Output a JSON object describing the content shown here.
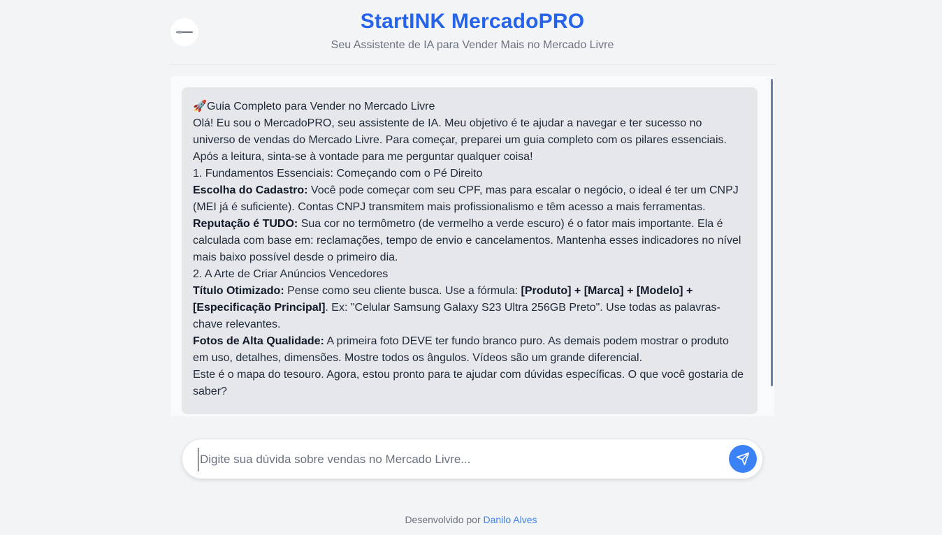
{
  "header": {
    "title": "StartINK MercadoPRO",
    "subtitle": "Seu Assistente de IA para Vender Mais no Mercado Livre"
  },
  "message": {
    "heading_icon": "rocket-icon",
    "heading_emoji": "🚀",
    "heading": "Guia Completo para Vender no Mercado Livre",
    "intro": "Olá! Eu sou o MercadoPRO, seu assistente de IA. Meu objetivo é te ajudar a navegar e ter sucesso no universo de vendas do Mercado Livre. Para começar, preparei um guia completo com os pilares essenciais. Após a leitura, sinta-se à vontade para me perguntar qualquer coisa!",
    "section1": "1. Fundamentos Essenciais: Começando com o Pé Direito",
    "cadastro_label": "Escolha do Cadastro:",
    "cadastro_text": " Você pode começar com seu CPF, mas para escalar o negócio, o ideal é ter um CNPJ (MEI já é suficiente). Contas CNPJ transmitem mais profissionalismo e têm acesso a mais ferramentas.",
    "reputacao_label": "Reputação é TUDO:",
    "reputacao_text": " Sua cor no termômetro (de vermelho a verde escuro) é o fator mais importante. Ela é calculada com base em: reclamações, tempo de envio e cancelamentos. Mantenha esses indicadores no nível mais baixo possível desde o primeiro dia.",
    "section2": "2. A Arte de Criar Anúncios Vencedores",
    "titulo_label": "Título Otimizado:",
    "titulo_text_a": " Pense como seu cliente busca. Use a fórmula: ",
    "titulo_formula": "[Produto] + [Marca] + [Modelo] + [Especificação Principal]",
    "titulo_text_b": ". Ex: \"Celular Samsung Galaxy S23 Ultra 256GB Preto\". Use todas as palavras-chave relevantes.",
    "fotos_label": "Fotos de Alta Qualidade:",
    "fotos_text": " A primeira foto DEVE ter fundo branco puro. As demais podem mostrar o produto em uso, detalhes, dimensões. Mostre todos os ângulos. Vídeos são um grande diferencial.",
    "closing": "Este é o mapa do tesouro. Agora, estou pronto para te ajudar com dúvidas específicas. O que você gostaria de saber?"
  },
  "input": {
    "placeholder": "Digite sua dúvida sobre vendas no Mercado Livre...",
    "value": ""
  },
  "footer": {
    "prefix": "Desenvolvido por ",
    "author": "Danilo Alves"
  },
  "colors": {
    "brand": "#2563eb",
    "send_button": "#3b82f6",
    "bubble": "#e5e7eb",
    "background": "#f3f4f6"
  }
}
